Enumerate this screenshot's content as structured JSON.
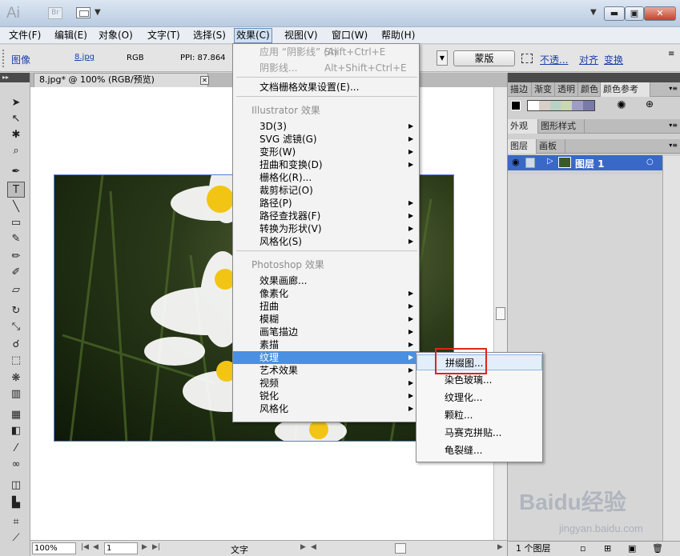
{
  "app": {
    "logo": "Ai",
    "bridge_label": "Br",
    "window_buttons": {
      "minimize": "▬",
      "maximize": "▣",
      "close": "✕"
    }
  },
  "menubar": [
    {
      "label": "文件(F)"
    },
    {
      "label": "编辑(E)"
    },
    {
      "label": "对象(O)"
    },
    {
      "label": "文字(T)"
    },
    {
      "label": "选择(S)"
    },
    {
      "label": "效果(C)",
      "active": true
    },
    {
      "label": "视图(V)"
    },
    {
      "label": "窗口(W)"
    },
    {
      "label": "帮助(H)"
    }
  ],
  "controlbar": {
    "image_label": "图像",
    "file_link": "8.jpg",
    "color_mode": "RGB",
    "ppi": "PPI: 87.864",
    "mask_button": "蒙版",
    "opacity_link": "不透...",
    "align_link": "对齐",
    "transform_link": "变换"
  },
  "document": {
    "tab_title": "8.jpg* @ 100% (RGB/预览)",
    "zoom": "100%",
    "page": "1",
    "status_text": "文字"
  },
  "effect_menu": {
    "items": [
      {
        "type": "item",
        "label": "应用 “阴影线” (A)",
        "shortcut": "Shift+Ctrl+E",
        "disabled": true
      },
      {
        "type": "item",
        "label": "阴影线...",
        "shortcut": "Alt+Shift+Ctrl+E",
        "disabled": true
      },
      {
        "type": "sep"
      },
      {
        "type": "item",
        "label": "文档栅格效果设置(E)..."
      },
      {
        "type": "sep"
      },
      {
        "type": "header",
        "label": "Illustrator 效果"
      },
      {
        "type": "item",
        "label": "3D(3)",
        "submenu": true
      },
      {
        "type": "item",
        "label": "SVG 滤镜(G)",
        "submenu": true
      },
      {
        "type": "item",
        "label": "变形(W)",
        "submenu": true
      },
      {
        "type": "item",
        "label": "扭曲和变换(D)",
        "submenu": true
      },
      {
        "type": "item",
        "label": "栅格化(R)..."
      },
      {
        "type": "item",
        "label": "裁剪标记(O)"
      },
      {
        "type": "item",
        "label": "路径(P)",
        "submenu": true
      },
      {
        "type": "item",
        "label": "路径查找器(F)",
        "submenu": true
      },
      {
        "type": "item",
        "label": "转换为形状(V)",
        "submenu": true
      },
      {
        "type": "item",
        "label": "风格化(S)",
        "submenu": true
      },
      {
        "type": "sep"
      },
      {
        "type": "header",
        "label": "Photoshop 效果"
      },
      {
        "type": "item",
        "label": "效果画廊..."
      },
      {
        "type": "item",
        "label": "像素化",
        "submenu": true
      },
      {
        "type": "item",
        "label": "扭曲",
        "submenu": true
      },
      {
        "type": "item",
        "label": "模糊",
        "submenu": true
      },
      {
        "type": "item",
        "label": "画笔描边",
        "submenu": true
      },
      {
        "type": "item",
        "label": "素描",
        "submenu": true
      },
      {
        "type": "item",
        "label": "纹理",
        "submenu": true,
        "highlighted": true
      },
      {
        "type": "item",
        "label": "艺术效果",
        "submenu": true
      },
      {
        "type": "item",
        "label": "视频",
        "submenu": true
      },
      {
        "type": "item",
        "label": "锐化",
        "submenu": true
      },
      {
        "type": "item",
        "label": "风格化",
        "submenu": true
      }
    ]
  },
  "texture_submenu": [
    {
      "label": "拼缀图...",
      "highlighted": true
    },
    {
      "label": "染色玻璃..."
    },
    {
      "label": "纹理化..."
    },
    {
      "label": "颗粒..."
    },
    {
      "label": "马赛克拼贴..."
    },
    {
      "label": "龟裂缝..."
    }
  ],
  "panels": {
    "tabs_top": [
      "描边",
      "渐变",
      "透明",
      "颜色",
      "颜色参考"
    ],
    "tabs_mid": [
      "外观",
      "图形样式"
    ],
    "tabs_layers": [
      "图层",
      "画板"
    ],
    "layer_name": "图层 1",
    "layer_count": "1 个图层",
    "swatch_colors": [
      "#ffffff",
      "#d8cfc8",
      "#b7d3c4",
      "#c9d7b3",
      "#9e9dc2",
      "#7a7aa8"
    ]
  },
  "watermark": {
    "main": "Baidu经验",
    "sub": "jingyan.baidu.com"
  }
}
